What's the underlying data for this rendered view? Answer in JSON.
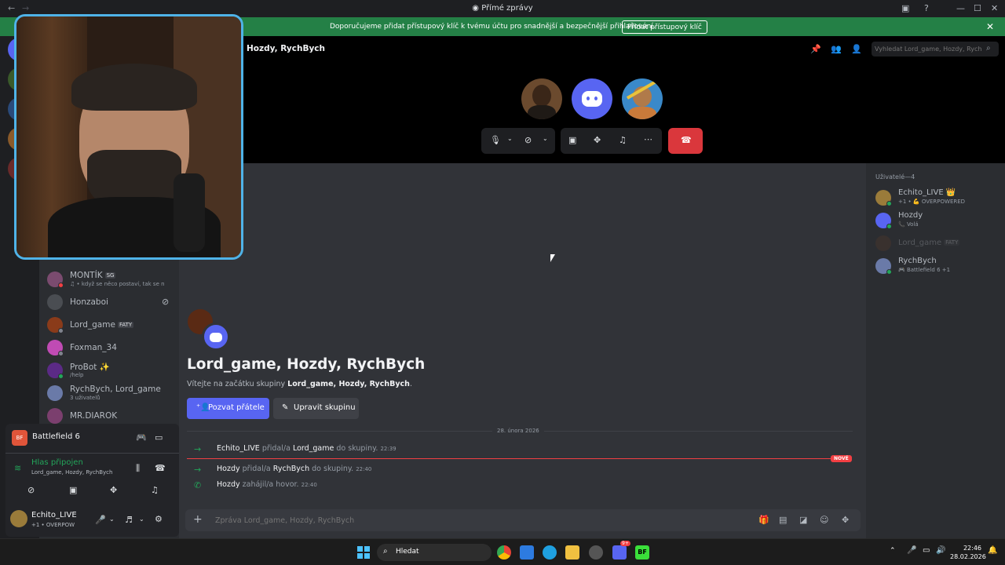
{
  "window": {
    "title": "Přímé zprávy",
    "back_icon": "arrow-left-icon",
    "forward_icon": "arrow-right-icon"
  },
  "notice": {
    "text": "Doporučujeme přidat přístupový klíč k tvému účtu pro snadnější a bezpečnější přihlašování.",
    "button": "Přidat přístupový klíč",
    "color": "#248046"
  },
  "header": {
    "title": "Hozdy, RychBych",
    "search_placeholder": "Vyhledat Lord_game, Hozdy, Rych..."
  },
  "dm_list": [
    {
      "name": "MONTÍK",
      "badge": "SG",
      "sub": "♫ • když se něco postaví, tak se n",
      "color": "#7a4b6f",
      "status": "#f23f43"
    },
    {
      "name": "Honzaboi",
      "badge": "",
      "sub": "",
      "color": "#4a4d52",
      "status": ""
    },
    {
      "name": "Lord_game",
      "badge": "FATY",
      "sub": "",
      "color": "#8a3b1a",
      "status": "#80848e"
    },
    {
      "name": "Foxman_34",
      "badge": "",
      "sub": "",
      "color": "#c04bb4",
      "status": "#80848e"
    },
    {
      "name": "ProBot ✨",
      "badge": "",
      "sub": "/help",
      "color": "#5b2a86",
      "status": "#23a55a"
    },
    {
      "name": "RychBych, Lord_game",
      "badge": "",
      "sub": "3 uživatelů",
      "color": "#6a7aa8",
      "status": ""
    },
    {
      "name": "MR.DIAROK",
      "badge": "",
      "sub": "",
      "color": "#7b3f6e",
      "status": ""
    }
  ],
  "game_panel": {
    "game": "Battlefield 6",
    "voice_status": "Hlas připojen",
    "voice_channel": "Lord_game, Hozdy, RychBych",
    "user_name": "Echito_LIVE",
    "user_sub": "+1 • OVERPOW"
  },
  "chat": {
    "group_title": "Lord_game, Hozdy, RychBych",
    "welcome_prefix": "Vítejte na začátku skupiny",
    "welcome_names": "Lord_game, Hozdy, RychBych",
    "welcome_suffix": ".",
    "invite_button": "Pozvat přátele",
    "edit_button": "Upravit skupinu",
    "date_divider": "28. února 2026",
    "new_label": "NOVÉ",
    "messages": [
      {
        "actor": "Echito_LIVE",
        "verb": "přidal/a",
        "target": "Lord_game",
        "rest": "do skupiny.",
        "time": "22:39"
      },
      {
        "actor": "Hozdy",
        "verb": "přidal/a",
        "target": "RychBych",
        "rest": "do skupiny.",
        "time": "22:40"
      },
      {
        "actor": "Hozdy",
        "verb": "zahájil/a hovor.",
        "target": "",
        "rest": "",
        "time": "22:40"
      }
    ],
    "input_placeholder": "Zpráva Lord_game, Hozdy, RychBych"
  },
  "members": {
    "header": "Uživatelé—4",
    "list": [
      {
        "name": "Echito_LIVE 👑",
        "sub": "+1 • 💪 OVERPOWERED",
        "color": "#9a7b3a"
      },
      {
        "name": "Hozdy",
        "sub": "📞 Volá",
        "color": "#5865f2"
      },
      {
        "name": "Lord_game",
        "badge": "FATY",
        "sub": "",
        "color": "#5a3b2a"
      },
      {
        "name": "RychBych",
        "sub": "🎮 Battlefield 6 +1",
        "color": "#6a7aa8"
      }
    ]
  },
  "taskbar": {
    "search": "Hledat",
    "time": "22:46",
    "date": "28.02.2026",
    "discord_badge": "9+"
  },
  "accent": "#5865f2",
  "hangup_color": "#da373c"
}
